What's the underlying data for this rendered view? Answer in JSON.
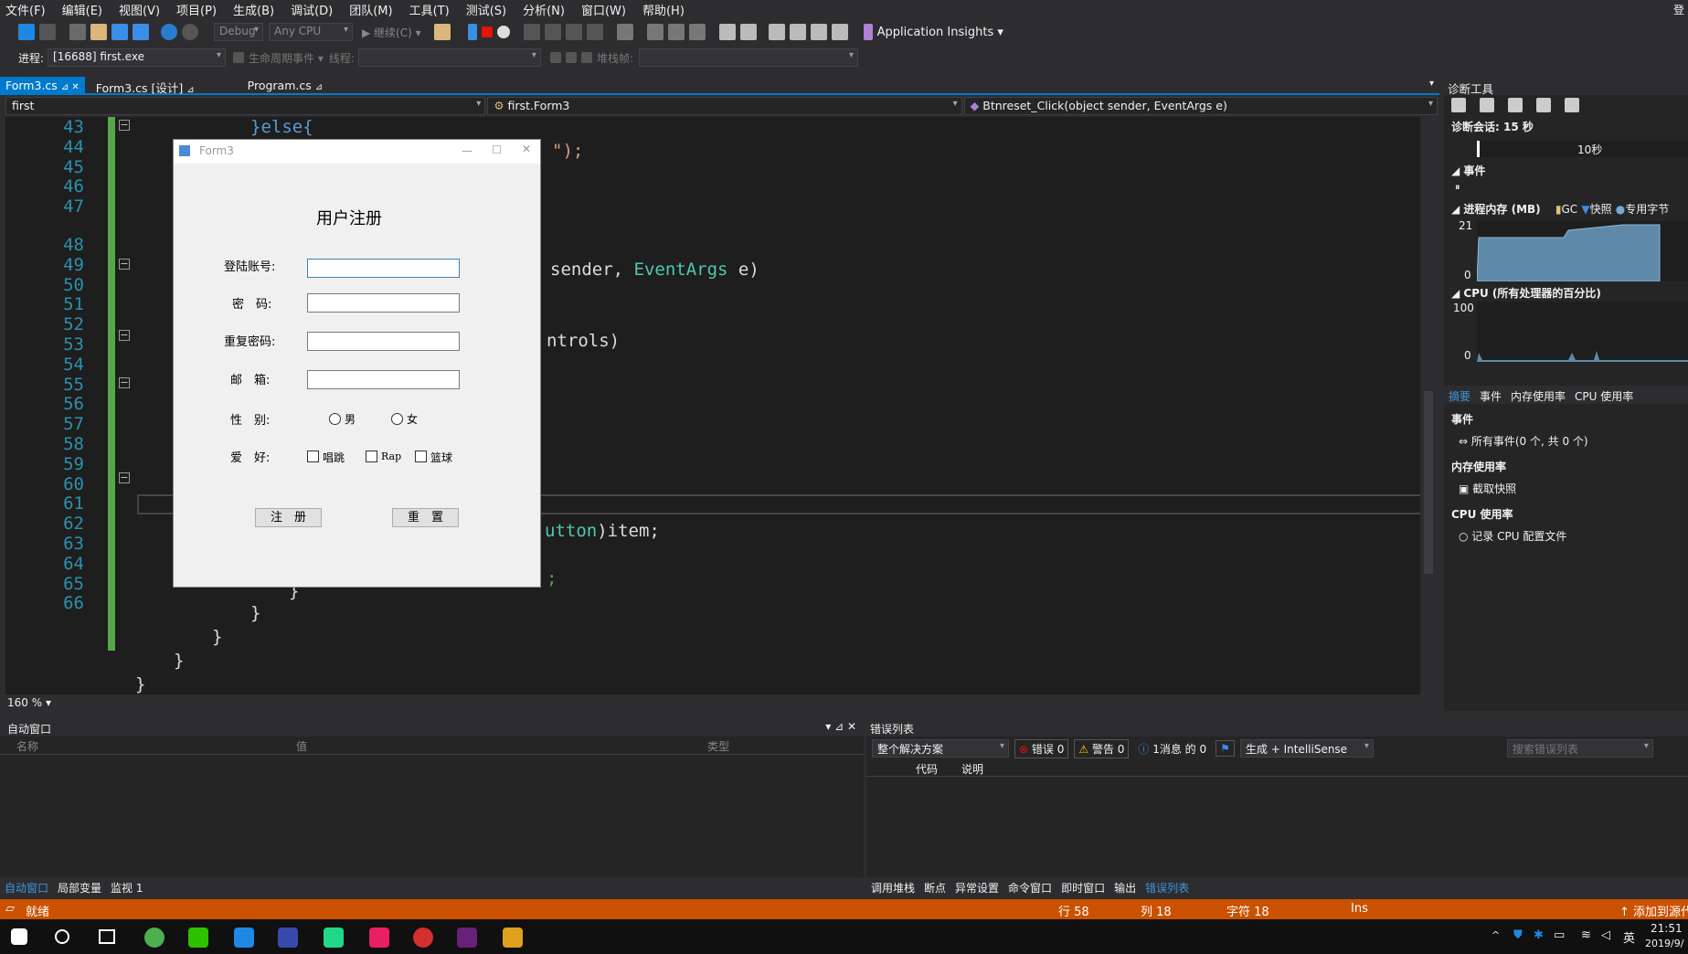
{
  "menu": [
    "文件(F)",
    "编辑(E)",
    "视图(V)",
    "项目(P)",
    "生成(B)",
    "调试(D)",
    "团队(M)",
    "工具(T)",
    "测试(S)",
    "分析(N)",
    "窗口(W)",
    "帮助(H)"
  ],
  "menu_right": "登",
  "toolbar": {
    "config": "Debug",
    "platform": "Any CPU",
    "continue": "▶ 继续(C) ▾",
    "app_insights": "Application Insights ▾"
  },
  "toolbar2": {
    "process_label": "进程:",
    "process_value": "[16688] first.exe",
    "lifecycle": "生命周期事件 ▾",
    "thread_label": "线程:",
    "stack_label": "堆栈帧:"
  },
  "tabs": [
    {
      "label": "Form3.cs",
      "pin": "⊿ ✕"
    },
    {
      "label": "Form3.cs [设计]",
      "pin": "⊿"
    },
    {
      "label": "Program.cs",
      "pin": "⊿"
    }
  ],
  "nav": {
    "project": "first",
    "class": "first.Form3",
    "member": "Btnreset_Click(object sender, EventArgs e)"
  },
  "lines": [
    "43",
    "44",
    "45",
    "46",
    "47",
    "48",
    "49",
    "50",
    "51",
    "52",
    "53",
    "54",
    "55",
    "56",
    "57",
    "58",
    "59",
    "60",
    "61",
    "62",
    "63",
    "64",
    "65",
    "66"
  ],
  "code": {
    "l43": "}else{",
    "l44": "\");",
    "l48a": "sender, ",
    "l48b": "EventArgs",
    "l48c": " e)",
    "l51": "ntrols)",
    "l59a": "utton",
    "l59b": ")item;",
    "l61": ";",
    "l62": "}",
    "l63": "}",
    "l64": "}",
    "l65": "}",
    "l66": "}"
  },
  "zoom": "160 %",
  "form": {
    "title": "Form3",
    "heading": "用户注册",
    "account": "登陆账号:",
    "password": "密　码:",
    "repeat": "重复密码:",
    "email": "邮　箱:",
    "gender": "性　别:",
    "male": "男",
    "female": "女",
    "hobby": "爱　好:",
    "h1": "唱跳",
    "h2": "Rap",
    "h3": "篮球",
    "register": "注　册",
    "reset": "重　置"
  },
  "diag": {
    "title": "诊断工具",
    "session": "诊断会话: 15 秒",
    "tick": "10秒",
    "events": "事件",
    "memory": "进程内存 (MB)",
    "gc": "GC",
    "snapshot": "快照",
    "private": "专用字节",
    "mem_max": "21",
    "mem_min": "0",
    "cpu": "CPU (所有处理器的百分比)",
    "cpu_max": "100",
    "cpu_min": "0",
    "tabs": [
      "摘要",
      "事件",
      "内存使用率",
      "CPU 使用率"
    ],
    "sec_events": "事件",
    "all_events": "所有事件(0 个, 共 0 个)",
    "sec_mem": "内存使用率",
    "take_snap": "截取快照",
    "sec_cpu": "CPU 使用率",
    "record_cpu": "记录 CPU 配置文件"
  },
  "auto": {
    "title": "自动窗口",
    "col_name": "名称",
    "col_value": "值",
    "col_type": "类型",
    "tabs": [
      "自动窗口",
      "局部变量",
      "监视 1"
    ]
  },
  "errors": {
    "title": "错误列表",
    "scope": "整个解决方案",
    "err": "错误 0",
    "warn": "警告 0",
    "msg": "1消息 的 0",
    "build": "生成 + IntelliSense",
    "search": "搜索错误列表",
    "col_code": "代码",
    "col_desc": "说明",
    "tabs": [
      "调用堆栈",
      "断点",
      "异常设置",
      "命令窗口",
      "即时窗口",
      "输出",
      "错误列表"
    ]
  },
  "status": {
    "ready": "就绪",
    "row": "行 58",
    "col": "列 18",
    "ch": "字符 18",
    "ins": "Ins",
    "add": "↑ 添加到源代"
  },
  "taskbar": {
    "time": "21:51",
    "date": "2019/9/",
    "ime": "英"
  }
}
